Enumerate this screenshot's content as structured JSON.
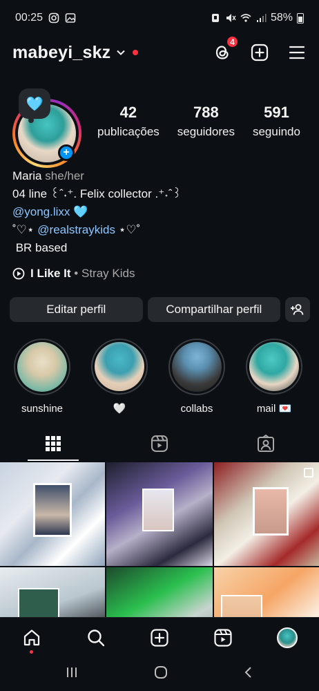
{
  "status_bar": {
    "time": "00:25",
    "battery": "58%"
  },
  "header": {
    "username": "mabeyi_skz",
    "threads_badge": "4"
  },
  "profile": {
    "note_emoji": "🩵",
    "stats": [
      {
        "value": "42",
        "label": "publicações"
      },
      {
        "value": "788",
        "label": "seguidores"
      },
      {
        "value": "591",
        "label": "seguindo"
      }
    ],
    "name": "Maria",
    "pronouns": "she/her",
    "bio_line1": "04 line ꒰ˆ˖⁺. Felix collector .⁺˖ˆ꒱",
    "bio_mention1": "@yong.lixx",
    "bio_mention1_suffix": " 🩵",
    "bio_line3_prefix": "˚♡⋆ ",
    "bio_mention2": "@realstraykids",
    "bio_line3_suffix": " ⋆♡˚",
    "bio_line4": " BR based",
    "music_song": "I Like It",
    "music_sep": " • ",
    "music_artist": "Stray Kids"
  },
  "buttons": {
    "edit": "Editar perfil",
    "share": "Compartilhar perfil"
  },
  "highlights": [
    {
      "label": "sunshine"
    },
    {
      "label": "🤍"
    },
    {
      "label": "collabs"
    },
    {
      "label": "mail 💌"
    }
  ],
  "tabs": [
    {
      "icon": "grid-icon"
    },
    {
      "icon": "reels-icon"
    },
    {
      "icon": "tagged-icon"
    }
  ],
  "colors": {
    "background": "#0c1014",
    "button": "#262a2f",
    "link": "#8fc6ff",
    "badge": "#ff3040",
    "accent": "#0095f6"
  }
}
